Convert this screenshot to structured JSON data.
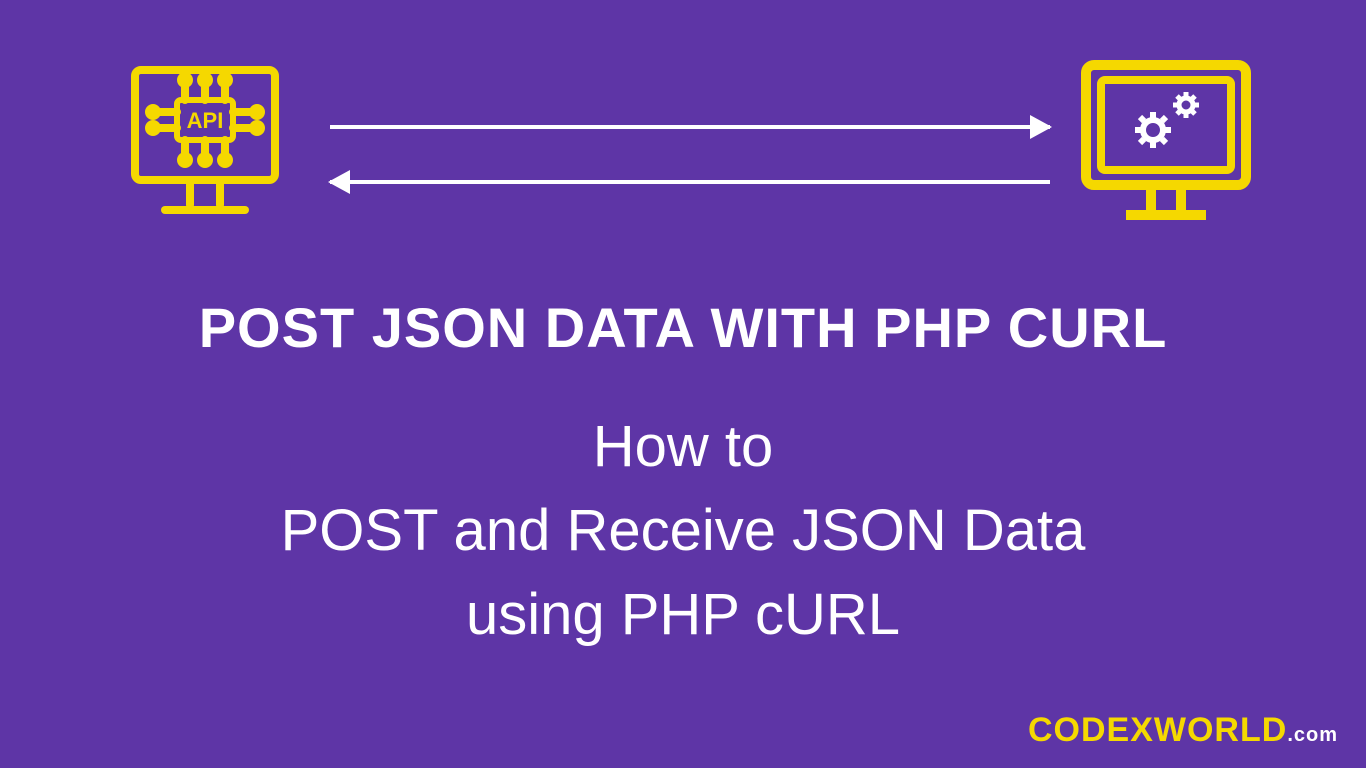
{
  "api_label": "API",
  "title": "POST JSON Data with PHP cURL",
  "subtitle_line1": "How to",
  "subtitle_line2": "POST and Receive JSON Data",
  "subtitle_line3": "using PHP cURL",
  "brand_name": "CODEXWORLD",
  "brand_tld": ".com",
  "colors": {
    "bg": "#5E35A6",
    "accent": "#F5D800",
    "text": "#FFFFFF"
  }
}
